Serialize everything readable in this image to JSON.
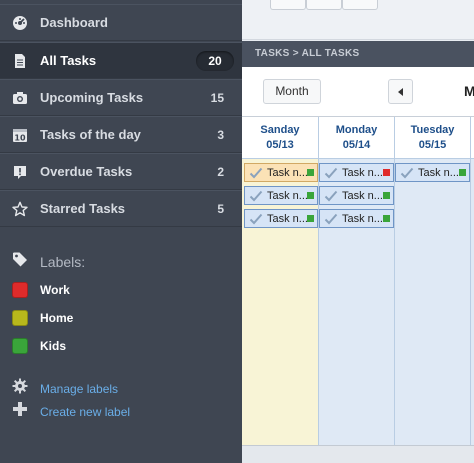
{
  "sidebar": {
    "nav": [
      {
        "label": "Dashboard",
        "count": "",
        "icon": "dashboard-icon",
        "active": false
      },
      {
        "label": "All Tasks",
        "count": "20",
        "icon": "document-icon",
        "active": true
      },
      {
        "label": "Upcoming Tasks",
        "count": "15",
        "icon": "camera-icon",
        "active": false
      },
      {
        "label": "Tasks of the day",
        "count": "3",
        "icon": "calendar-day-icon",
        "active": false
      },
      {
        "label": "Overdue Tasks",
        "count": "2",
        "icon": "alert-icon",
        "active": false
      },
      {
        "label": "Starred Tasks",
        "count": "5",
        "icon": "star-icon",
        "active": false
      }
    ],
    "labels_heading": "Labels:",
    "labels": [
      {
        "name": "Work",
        "color": "#e02b2b"
      },
      {
        "name": "Home",
        "color": "#b8b81c"
      },
      {
        "name": "Kids",
        "color": "#3aa53a"
      }
    ],
    "manage_labels": "Manage labels",
    "create_label": "Create new label"
  },
  "breadcrumb": "TASKS > ALL TASKS",
  "toolbar": {
    "view_button": "Month",
    "period_label": "M"
  },
  "calendar": {
    "days": [
      {
        "name": "Sanday",
        "date": "05/13",
        "highlight": true,
        "tasks": [
          {
            "name": "Task n...",
            "flag_color": "#3aa53a",
            "highlight": true
          },
          {
            "name": "Task n...",
            "flag_color": "#3aa53a",
            "highlight": false
          },
          {
            "name": "Task n...",
            "flag_color": "#3aa53a",
            "highlight": false
          }
        ]
      },
      {
        "name": "Monday",
        "date": "05/14",
        "highlight": false,
        "tasks": [
          {
            "name": "Task n...",
            "flag_color": "#e02b2b",
            "highlight": false
          },
          {
            "name": "Task n...",
            "flag_color": "#3aa53a",
            "highlight": false
          },
          {
            "name": "Task n...",
            "flag_color": "#3aa53a",
            "highlight": false
          }
        ]
      },
      {
        "name": "Tuesday",
        "date": "05/15",
        "highlight": false,
        "tasks": [
          {
            "name": "Task n...",
            "flag_color": "#3aa53a",
            "highlight": false
          }
        ]
      }
    ]
  },
  "colors": {
    "sidebar_bg": "#3f4652",
    "sidebar_active_bg": "#2f353f",
    "link": "#6aaee8",
    "day_header_text": "#1e4f8a",
    "today_col": "#f8f4d6",
    "day_col": "#dfe9f5"
  }
}
